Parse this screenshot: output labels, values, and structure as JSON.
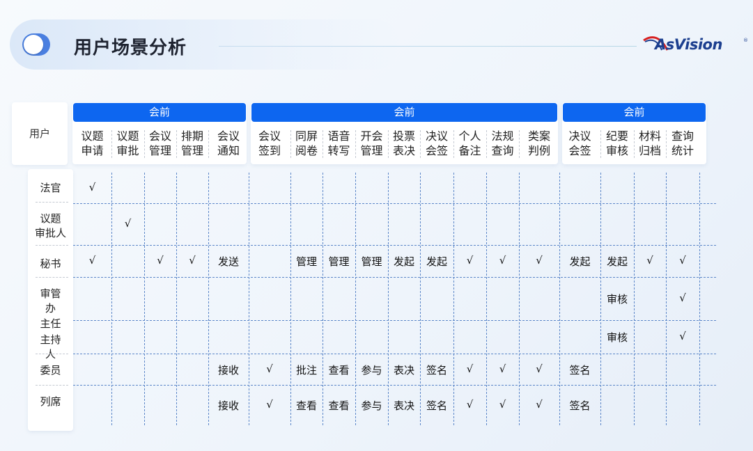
{
  "title": "用户场景分析",
  "logo": {
    "brand_main": "AsVision",
    "reg_mark": "®",
    "accent": "#d72020",
    "brand_color": "#1c3f8f"
  },
  "colors": {
    "phase_bar": "#0d66f0",
    "grid_line": "#5b86c8"
  },
  "user_header": "用户",
  "phases": [
    {
      "label": "会前",
      "functions": [
        [
          "议题",
          "申请"
        ],
        [
          "议题",
          "审批"
        ],
        [
          "会议",
          "管理"
        ],
        [
          "排期",
          "管理"
        ],
        [
          "会议",
          "通知"
        ]
      ]
    },
    {
      "label": "会前",
      "functions": [
        [
          "会议",
          "签到"
        ],
        [
          "同屏",
          "阅卷"
        ],
        [
          "语音",
          "转写"
        ],
        [
          "开会",
          "管理"
        ],
        [
          "投票",
          "表决"
        ],
        [
          "决议",
          "会签"
        ],
        [
          "个人",
          "备注"
        ],
        [
          "法规",
          "查询"
        ],
        [
          "类案",
          "判例"
        ]
      ]
    },
    {
      "label": "会前",
      "functions": [
        [
          "决议",
          "会签"
        ],
        [
          "纪要",
          "审核"
        ],
        [
          "材料",
          "归档"
        ],
        [
          "查询",
          "统计"
        ]
      ]
    }
  ],
  "roles": [
    {
      "lines": [
        "法官"
      ]
    },
    {
      "lines": [
        "议题",
        "审批人"
      ]
    },
    {
      "lines": [
        "秘书"
      ]
    },
    {
      "lines": [
        "审管",
        "办"
      ]
    },
    {
      "lines": [
        "主任"
      ]
    },
    {
      "lines": [
        "主持",
        "人"
      ]
    },
    {
      "lines": [
        "委员"
      ]
    },
    {
      "lines": [
        "列席"
      ]
    }
  ],
  "matrix_rows": [
    [
      "√",
      "",
      "",
      "",
      "",
      "",
      "",
      "",
      "",
      "",
      "",
      "",
      "",
      "",
      "",
      "",
      "",
      ""
    ],
    [
      "",
      "√",
      "",
      "",
      "",
      "",
      "",
      "",
      "",
      "",
      "",
      "",
      "",
      "",
      "",
      "",
      "",
      ""
    ],
    [
      "√",
      "",
      "√",
      "√",
      "发送",
      "",
      "管理",
      "管理",
      "管理",
      "发起",
      "发起",
      "√",
      "√",
      "√",
      "发起",
      "发起",
      "√",
      "√"
    ],
    [
      "",
      "",
      "",
      "",
      "",
      "",
      "",
      "",
      "",
      "",
      "",
      "",
      "",
      "",
      "",
      "审核",
      "",
      "√"
    ],
    [
      "",
      "",
      "",
      "",
      "",
      "",
      "",
      "",
      "",
      "",
      "",
      "",
      "",
      "",
      "",
      "审核",
      "",
      "√"
    ],
    [
      "",
      "",
      "",
      "",
      "接收",
      "√",
      "批注",
      "查看",
      "参与",
      "表决",
      "签名",
      "√",
      "√",
      "√",
      "签名",
      "",
      "",
      ""
    ],
    [
      "",
      "",
      "",
      "",
      "接收",
      "√",
      "查看",
      "查看",
      "参与",
      "表决",
      "签名",
      "√",
      "√",
      "√",
      "签名",
      "",
      "",
      ""
    ]
  ]
}
